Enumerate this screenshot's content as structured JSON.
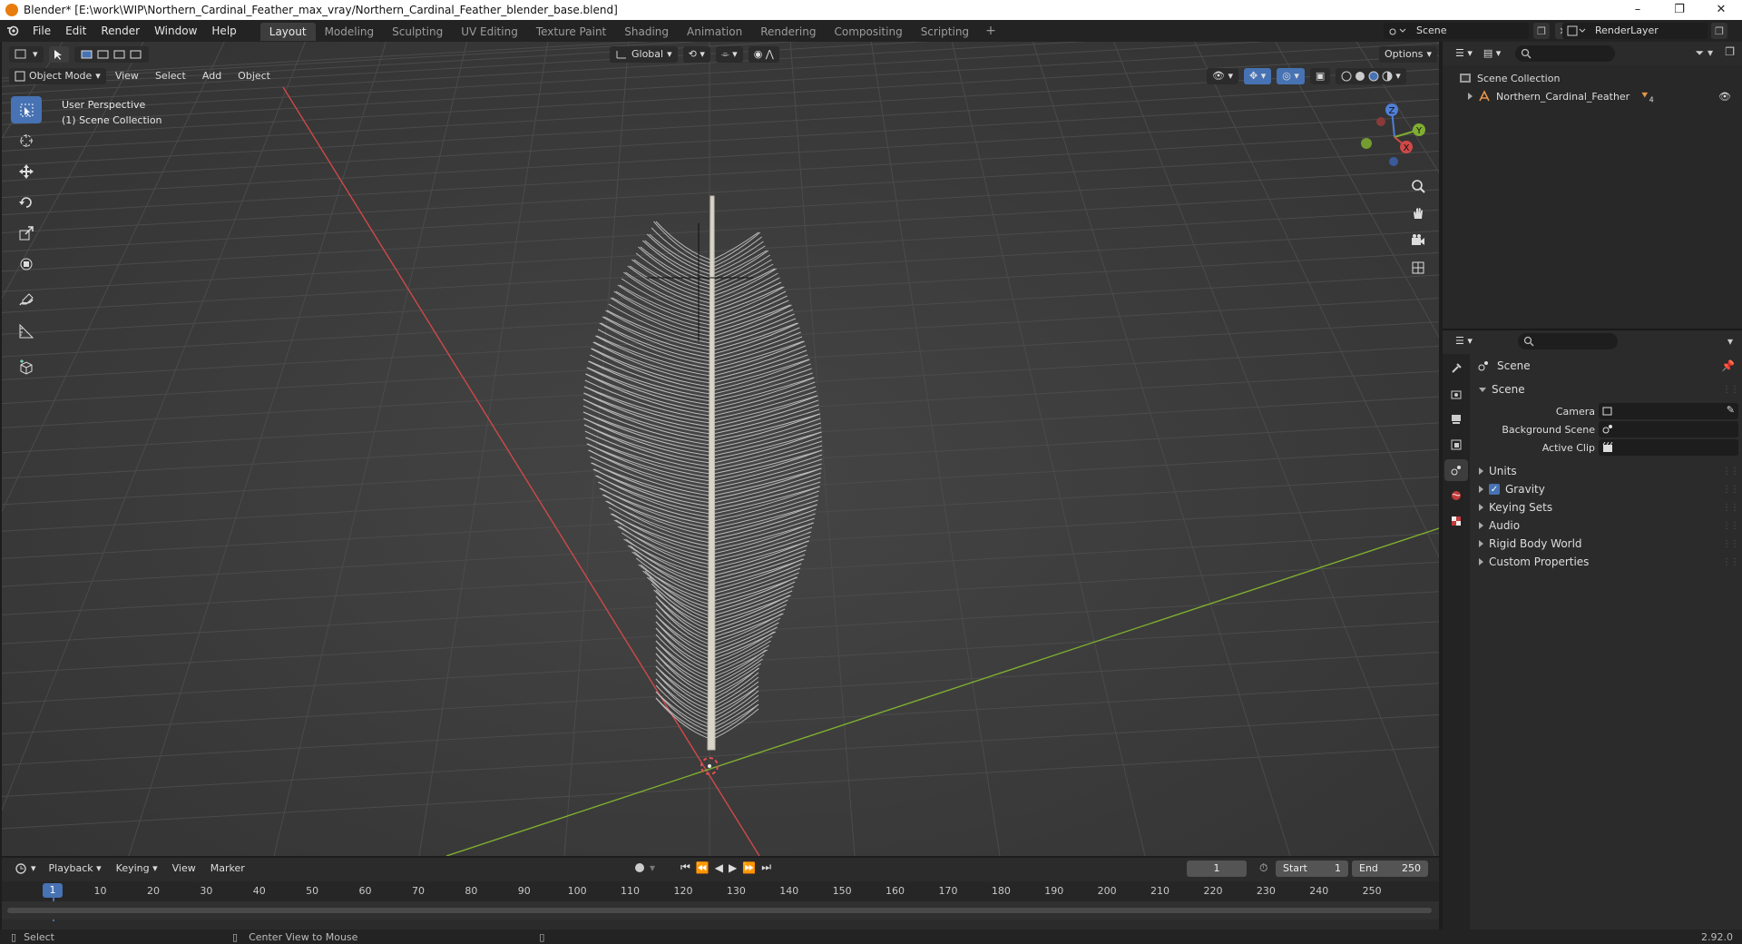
{
  "window": {
    "title": "Blender* [E:\\work\\WIP\\Northern_Cardinal_Feather_max_vray/Northern_Cardinal_Feather_blender_base.blend]",
    "controls": [
      "–",
      "❐",
      "✕"
    ]
  },
  "menu": [
    "File",
    "Edit",
    "Render",
    "Window",
    "Help"
  ],
  "workspaces": [
    {
      "label": "Layout",
      "active": true
    },
    {
      "label": "Modeling"
    },
    {
      "label": "Sculpting"
    },
    {
      "label": "UV Editing"
    },
    {
      "label": "Texture Paint"
    },
    {
      "label": "Shading"
    },
    {
      "label": "Animation"
    },
    {
      "label": "Rendering"
    },
    {
      "label": "Compositing"
    },
    {
      "label": "Scripting"
    }
  ],
  "workspace_add": "+",
  "scene_selector": "Scene",
  "render_layer": "RenderLayer",
  "viewport": {
    "mode": "Object Mode",
    "menus": [
      "View",
      "Select",
      "Add",
      "Object"
    ],
    "transform_orientation": "Global",
    "options": "Options",
    "overlay_line1": "User Perspective",
    "overlay_line2": "(1) Scene Collection",
    "gizmo": {
      "z": "Z",
      "y": "Y",
      "x": "X"
    }
  },
  "timeline": {
    "menus": [
      "Playback",
      "Keying",
      "View",
      "Marker"
    ],
    "current_frame": "1",
    "start_label": "Start",
    "start_value": "1",
    "end_label": "End",
    "end_value": "250",
    "ruler": [
      "1",
      "10",
      "20",
      "30",
      "40",
      "50",
      "60",
      "70",
      "80",
      "90",
      "100",
      "110",
      "120",
      "130",
      "140",
      "150",
      "160",
      "170",
      "180",
      "190",
      "200",
      "210",
      "220",
      "230",
      "240",
      "250"
    ]
  },
  "status": {
    "select": "Select",
    "center_view": "Center View to Mouse",
    "version": "2.92.0"
  },
  "outliner": {
    "root": "Scene Collection",
    "items": [
      {
        "label": "Northern_Cardinal_Feather",
        "badge": "4"
      }
    ]
  },
  "properties": {
    "context": "Scene",
    "panel": "Scene",
    "fields": [
      {
        "label": "Camera"
      },
      {
        "label": "Background Scene"
      },
      {
        "label": "Active Clip"
      }
    ],
    "subpanels": [
      {
        "label": "Units"
      },
      {
        "label": "Gravity",
        "checkbox": true
      },
      {
        "label": "Keying Sets"
      },
      {
        "label": "Audio"
      },
      {
        "label": "Rigid Body World"
      },
      {
        "label": "Custom Properties"
      }
    ]
  },
  "colors": {
    "accent": "#4772b3",
    "x_axis": "#d04848",
    "y_axis": "#7fae30",
    "viewport_bg": "#3a3a3a"
  }
}
